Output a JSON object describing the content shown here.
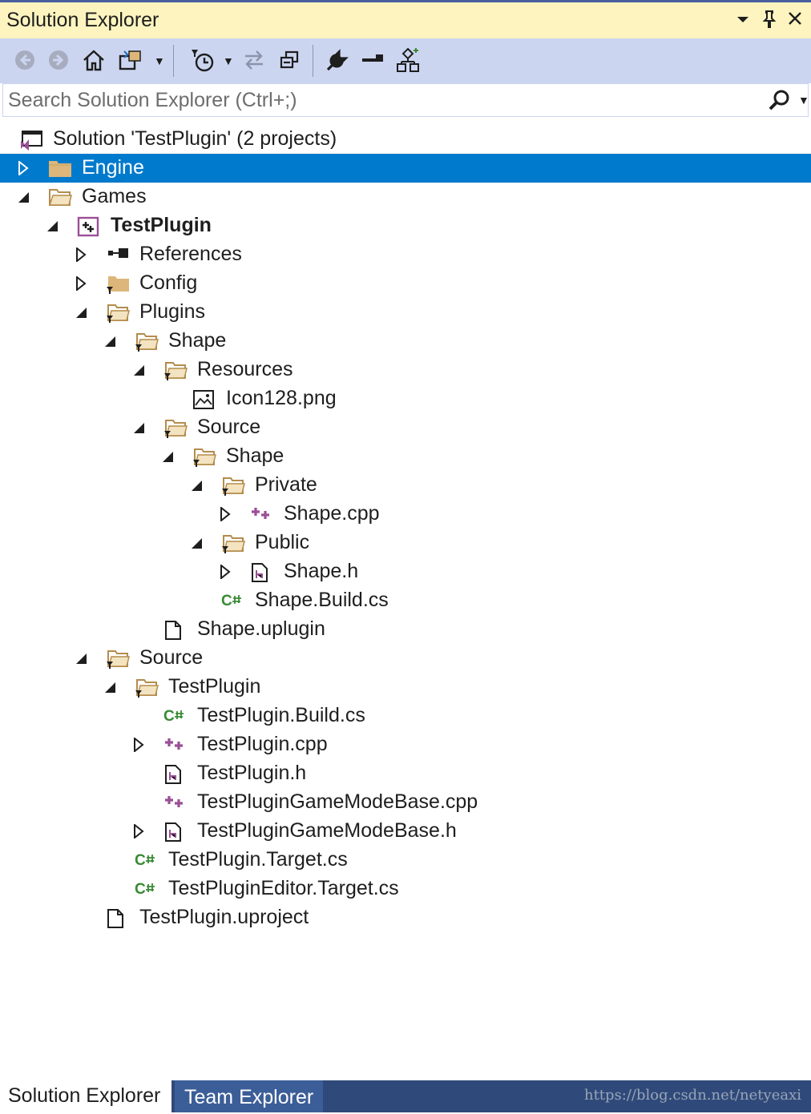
{
  "window": {
    "title": "Solution Explorer",
    "controls": {
      "dropdown": "▾",
      "pin": "📌",
      "close": "✕"
    }
  },
  "toolbar": {
    "buttons": [
      "back-icon",
      "forward-icon",
      "home-icon",
      "switch-views-icon",
      "pending-changes-filter-icon",
      "sync-icon",
      "collapse-all-icon",
      "properties-icon",
      "preview-icon",
      "class-view-icon"
    ]
  },
  "search": {
    "placeholder": "Search Solution Explorer (Ctrl+;)"
  },
  "tree": [
    {
      "label": "Solution 'TestPlugin' (2 projects)",
      "icon": "solution-icon",
      "expander": "none",
      "depth": 0
    },
    {
      "label": "Engine",
      "icon": "folder-icon",
      "expander": "collapsed",
      "depth": 0,
      "selected": true
    },
    {
      "label": "Games",
      "icon": "folder-open-icon",
      "expander": "expanded",
      "depth": 0
    },
    {
      "label": "TestPlugin",
      "icon": "cpp-project-icon",
      "expander": "expanded",
      "depth": 1,
      "bold": true
    },
    {
      "label": "References",
      "icon": "references-icon",
      "expander": "collapsed",
      "depth": 2
    },
    {
      "label": "Config",
      "icon": "filter-folder-icon",
      "expander": "collapsed",
      "depth": 2
    },
    {
      "label": "Plugins",
      "icon": "filter-folder-open-icon",
      "expander": "expanded",
      "depth": 2
    },
    {
      "label": "Shape",
      "icon": "filter-folder-open-icon",
      "expander": "expanded",
      "depth": 3
    },
    {
      "label": "Resources",
      "icon": "filter-folder-open-icon",
      "expander": "expanded",
      "depth": 4
    },
    {
      "label": "Icon128.png",
      "icon": "image-file-icon",
      "expander": "none",
      "depth": 5
    },
    {
      "label": "Source",
      "icon": "filter-folder-open-icon",
      "expander": "expanded",
      "depth": 4
    },
    {
      "label": "Shape",
      "icon": "filter-folder-open-icon",
      "expander": "expanded",
      "depth": 5
    },
    {
      "label": "Private",
      "icon": "filter-folder-open-icon",
      "expander": "expanded",
      "depth": 6
    },
    {
      "label": "Shape.cpp",
      "icon": "cpp-file-icon",
      "expander": "collapsed",
      "depth": 7
    },
    {
      "label": "Public",
      "icon": "filter-folder-open-icon",
      "expander": "expanded",
      "depth": 6
    },
    {
      "label": "Shape.h",
      "icon": "header-file-icon",
      "expander": "collapsed",
      "depth": 7
    },
    {
      "label": "Shape.Build.cs",
      "icon": "csharp-file-icon",
      "expander": "none",
      "depth": 6
    },
    {
      "label": "Shape.uplugin",
      "icon": "generic-file-icon",
      "expander": "none",
      "depth": 4
    },
    {
      "label": "Source",
      "icon": "filter-folder-open-icon",
      "expander": "expanded",
      "depth": 2
    },
    {
      "label": "TestPlugin",
      "icon": "filter-folder-open-icon",
      "expander": "expanded",
      "depth": 3
    },
    {
      "label": "TestPlugin.Build.cs",
      "icon": "csharp-file-icon",
      "expander": "none",
      "depth": 4
    },
    {
      "label": "TestPlugin.cpp",
      "icon": "cpp-file-icon",
      "expander": "collapsed",
      "depth": 4
    },
    {
      "label": "TestPlugin.h",
      "icon": "header-file-icon",
      "expander": "none",
      "depth": 4
    },
    {
      "label": "TestPluginGameModeBase.cpp",
      "icon": "cpp-file-icon",
      "expander": "none",
      "depth": 4
    },
    {
      "label": "TestPluginGameModeBase.h",
      "icon": "header-file-icon",
      "expander": "collapsed",
      "depth": 4
    },
    {
      "label": "TestPlugin.Target.cs",
      "icon": "csharp-file-icon",
      "expander": "none",
      "depth": 3
    },
    {
      "label": "TestPluginEditor.Target.cs",
      "icon": "csharp-file-icon",
      "expander": "none",
      "depth": 3
    },
    {
      "label": "TestPlugin.uproject",
      "icon": "generic-file-icon",
      "expander": "none",
      "depth": 2
    }
  ],
  "tabs": {
    "active": "Solution Explorer",
    "inactive": "Team Explorer"
  },
  "watermark": "https://blog.csdn.net/netyeaxi",
  "colors": {
    "title_bg": "#fdf4bf",
    "toolbar_bg": "#ccd5f0",
    "selection": "#007acc",
    "folder": "#dcb67a",
    "cpp": "#9b4f96",
    "csharp": "#388a34"
  }
}
